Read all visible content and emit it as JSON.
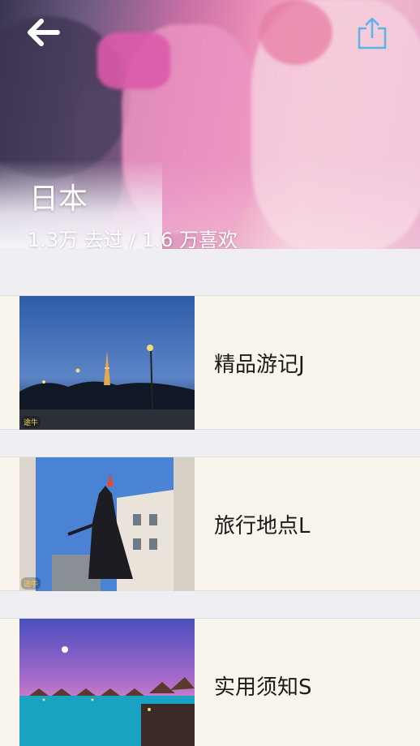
{
  "header": {
    "title": "日本",
    "stats": "1.3万 去过 / 1.6 万喜欢",
    "back_icon": "arrow-left-icon",
    "share_icon": "share-icon",
    "share_color": "#5ab4e6"
  },
  "cards": [
    {
      "label": "精品游记J",
      "image": "eiffel-tower-night-photo",
      "watermark": "途牛"
    },
    {
      "label": "旅行地点L",
      "image": "statue-street-photo",
      "watermark": "途牛"
    },
    {
      "label": "实用须知S",
      "image": "water-villas-sunset-photo",
      "watermark": ""
    }
  ]
}
